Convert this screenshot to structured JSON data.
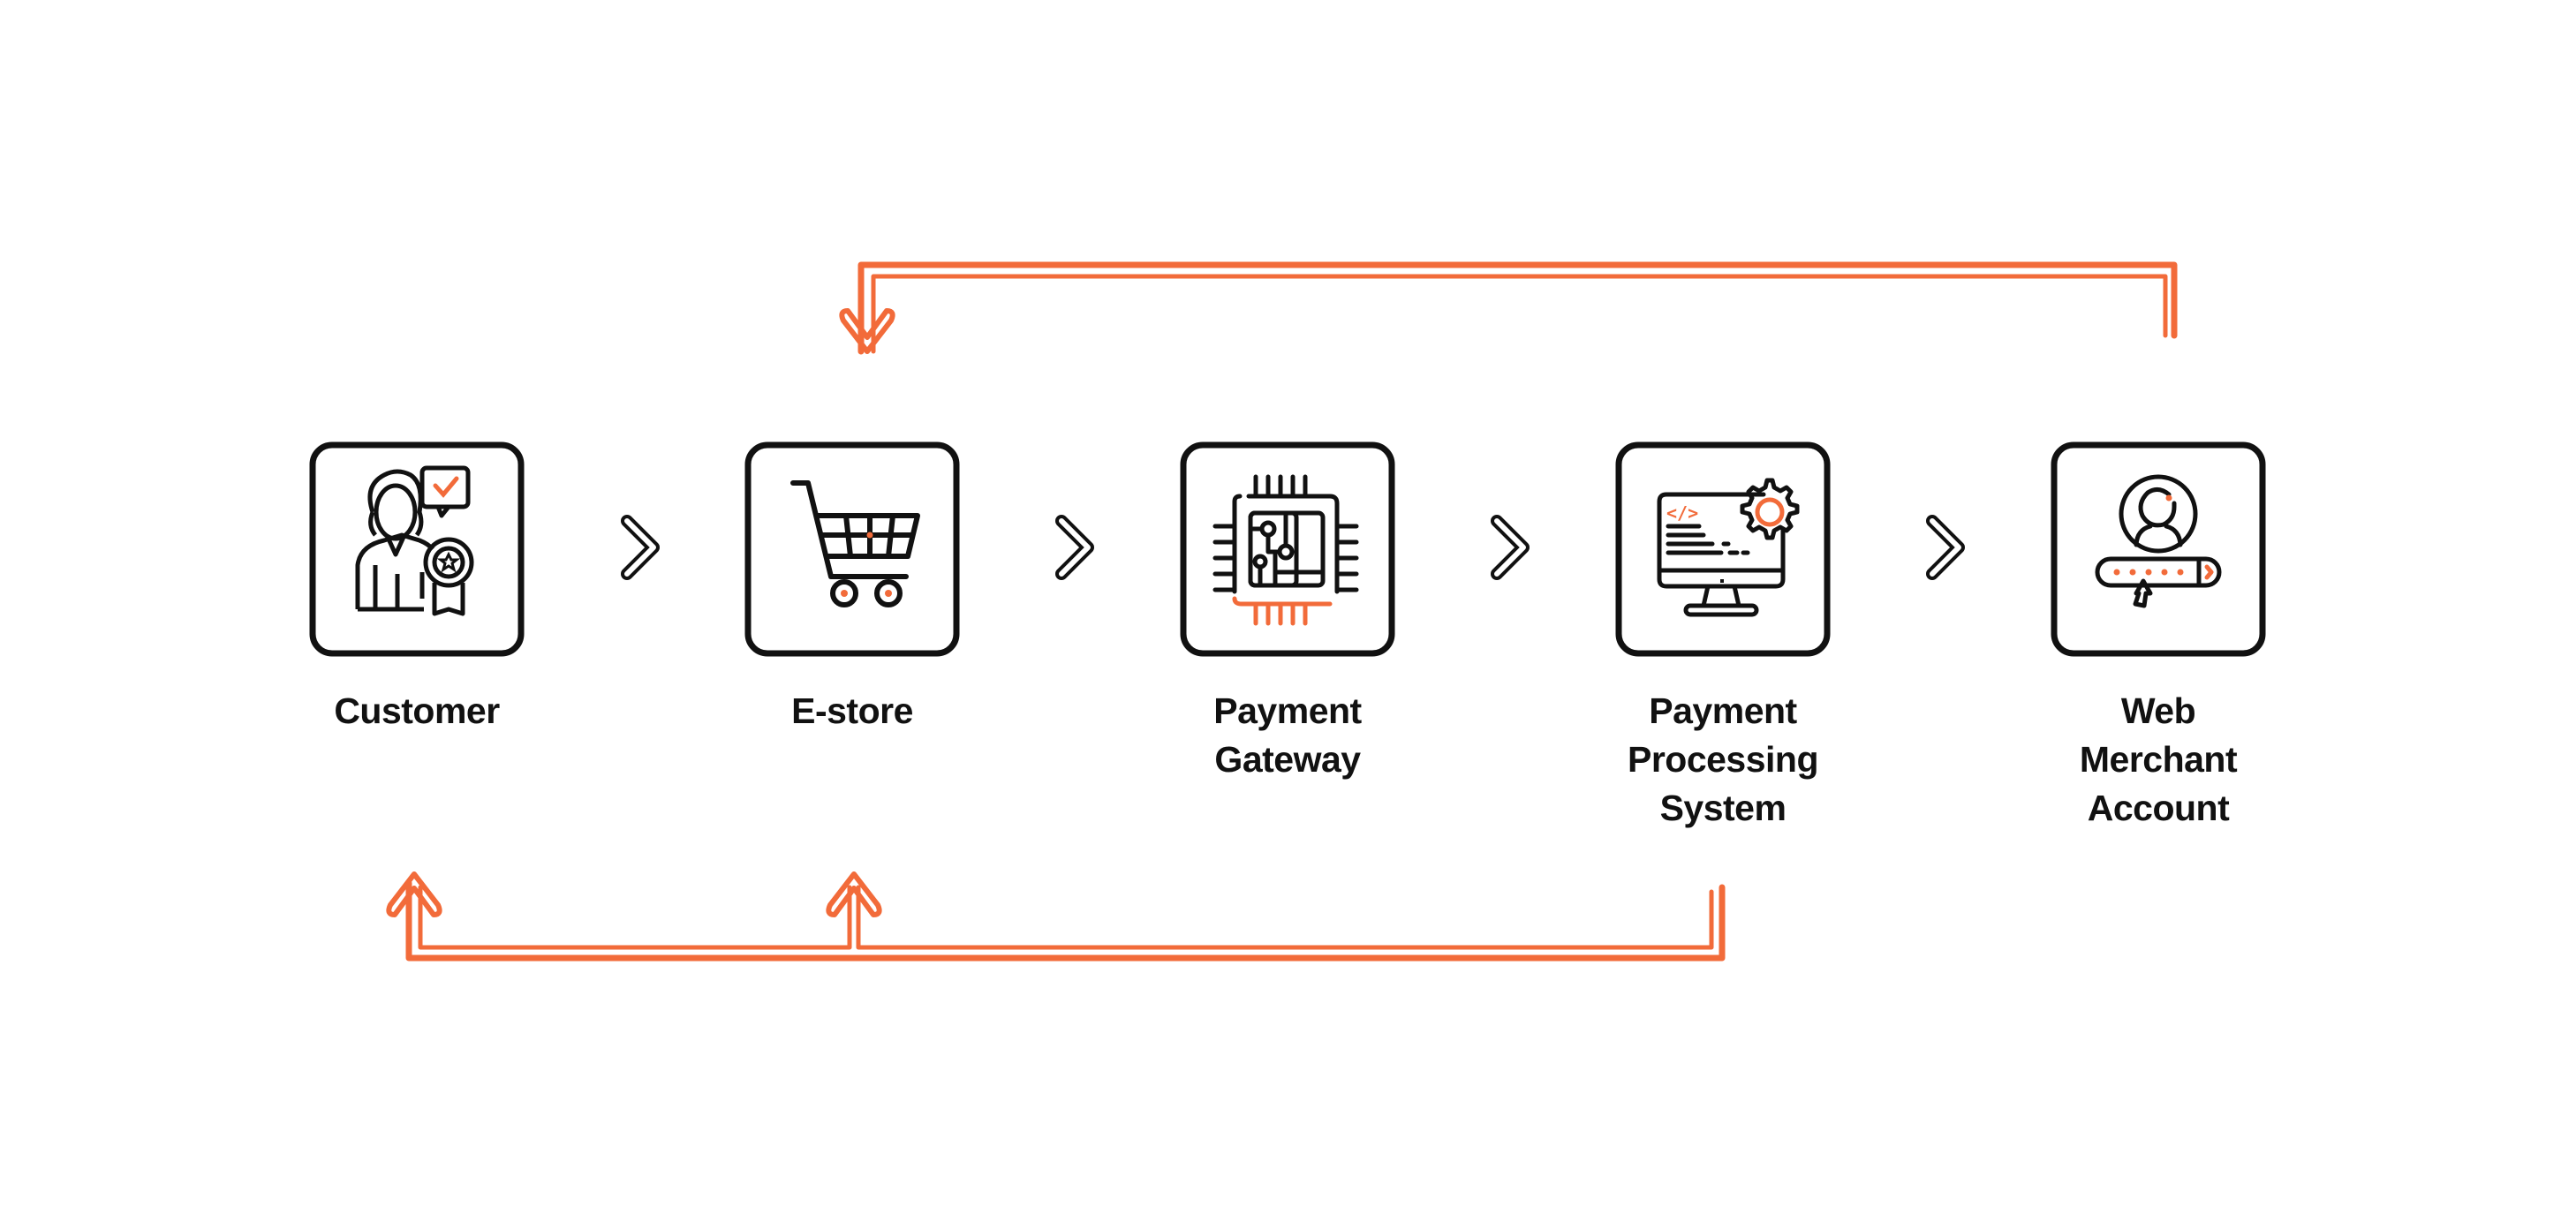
{
  "diagram": {
    "type": "payment-flow",
    "accent_color": "#F26B3A",
    "ink_color": "#111111",
    "nodes": [
      {
        "id": "customer",
        "icon": "customer-badge-icon",
        "label_lines": [
          "Customer"
        ]
      },
      {
        "id": "estore",
        "icon": "shopping-cart-icon",
        "label_lines": [
          "E-store"
        ]
      },
      {
        "id": "gateway",
        "icon": "chip-circuit-icon",
        "label_lines": [
          "Payment",
          "Gateway"
        ]
      },
      {
        "id": "pps",
        "icon": "monitor-gear-code-icon",
        "label_lines": [
          "Payment",
          "Processing",
          "System"
        ]
      },
      {
        "id": "wma",
        "icon": "user-login-password-icon",
        "label_lines": [
          "Web",
          "Merchant",
          "Account"
        ]
      }
    ],
    "forward_connectors": [
      {
        "from": "customer",
        "to": "estore",
        "icon": "chevron-right-icon"
      },
      {
        "from": "estore",
        "to": "gateway",
        "icon": "chevron-right-icon"
      },
      {
        "from": "gateway",
        "to": "pps",
        "icon": "chevron-right-icon"
      },
      {
        "from": "pps",
        "to": "wma",
        "icon": "chevron-right-icon"
      }
    ],
    "return_flows": [
      {
        "from": "wma",
        "to": [
          "estore"
        ],
        "side": "top"
      },
      {
        "from": "pps",
        "to": [
          "customer",
          "estore"
        ],
        "side": "bottom"
      }
    ]
  }
}
